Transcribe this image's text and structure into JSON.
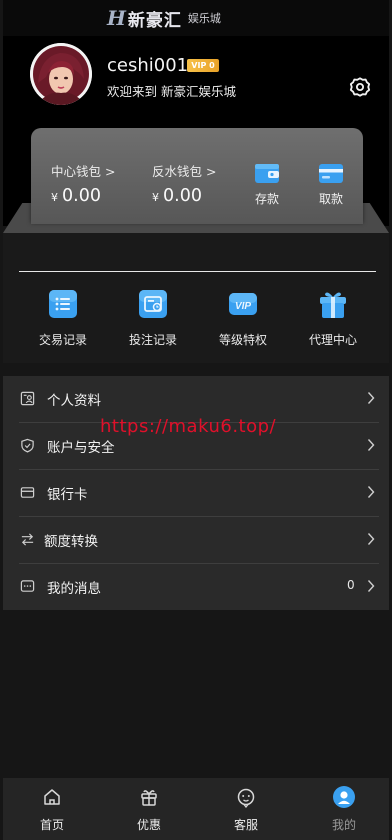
{
  "header": {
    "logo_mark": "H",
    "logo_name": "新豪汇",
    "logo_sub": "娱乐城"
  },
  "profile": {
    "username": "ceshi001",
    "vip_badge": "VIP 0",
    "welcome": "欢迎来到 新豪汇娱乐城"
  },
  "wallet": {
    "center": {
      "label": "中心钱包 >",
      "currency": "¥",
      "amount": "0.00"
    },
    "rebate": {
      "label": "反水钱包 >",
      "currency": "¥",
      "amount": "0.00"
    },
    "deposit_label": "存款",
    "withdraw_label": "取款"
  },
  "quick_menu": [
    {
      "label": "交易记录",
      "icon": "transaction-list-icon"
    },
    {
      "label": "投注记录",
      "icon": "bet-history-icon"
    },
    {
      "label": "等级特权",
      "icon": "vip-privilege-icon"
    },
    {
      "label": "代理中心",
      "icon": "agent-gift-icon"
    }
  ],
  "menu_list": [
    {
      "label": "个人资料",
      "icon": "profile-card-icon"
    },
    {
      "label": "账户与安全",
      "icon": "shield-icon"
    },
    {
      "label": "银行卡",
      "icon": "bank-card-icon"
    },
    {
      "label": "额度转换",
      "icon": "transfer-arrows-icon"
    },
    {
      "label": "我的消息",
      "icon": "message-icon",
      "count": "0"
    }
  ],
  "watermark": "https://maku6.top/",
  "tabbar": [
    {
      "label": "首页",
      "icon": "home-icon"
    },
    {
      "label": "优惠",
      "icon": "gift-icon"
    },
    {
      "label": "客服",
      "icon": "support-icon"
    },
    {
      "label": "我的",
      "icon": "user-icon",
      "active": true
    }
  ],
  "colors": {
    "accent_blue": "#3aa0f0",
    "vip_gold": "#f0b43a",
    "watermark_red": "#e0102a"
  }
}
